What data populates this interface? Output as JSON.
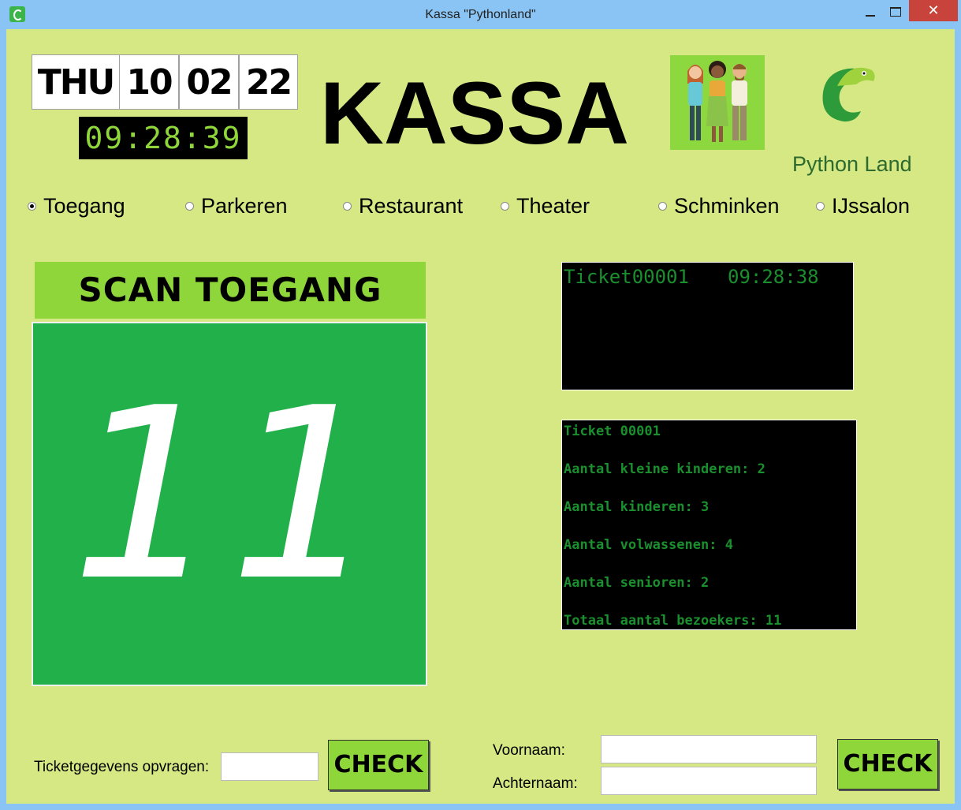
{
  "window": {
    "title": "Kassa \"Pythonland\"",
    "close_glyph": "✕"
  },
  "date": {
    "day": "THU",
    "dd": "10",
    "mm": "02",
    "yy": "22"
  },
  "clock": "09:28:39",
  "heading": "KASSA",
  "logo": {
    "text": "Python Land"
  },
  "modes": [
    {
      "label": "Toegang",
      "selected": true
    },
    {
      "label": "Parkeren",
      "selected": false
    },
    {
      "label": "Restaurant",
      "selected": false
    },
    {
      "label": "Theater",
      "selected": false
    },
    {
      "label": "Schminken",
      "selected": false
    },
    {
      "label": "IJssalon",
      "selected": false
    }
  ],
  "scan": {
    "title": "SCAN TOEGANG",
    "count": "11"
  },
  "last_ticket": {
    "id": "Ticket00001",
    "time": "09:28:38"
  },
  "ticket_details": [
    "Ticket 00001",
    "Aantal kleine kinderen: 2",
    "Aantal kinderen: 3",
    "Aantal volwassenen: 4",
    "Aantal senioren: 2",
    "Totaal aantal bezoekers: 11"
  ],
  "lookup": {
    "label": "Ticketgegevens opvragen:",
    "value": "",
    "button": "CHECK"
  },
  "name_form": {
    "first_label": "Voornaam:",
    "last_label": "Achternaam:",
    "first_value": "",
    "last_value": "",
    "button": "CHECK"
  },
  "colors": {
    "background": "#d6e883",
    "accent": "#8fd63b",
    "scan_green": "#22b04b",
    "terminal_text": "#1a8f2e"
  },
  "icons": [
    "app-icon",
    "minimize-icon",
    "maximize-icon",
    "close-icon",
    "people-illustration",
    "python-land-logo"
  ]
}
